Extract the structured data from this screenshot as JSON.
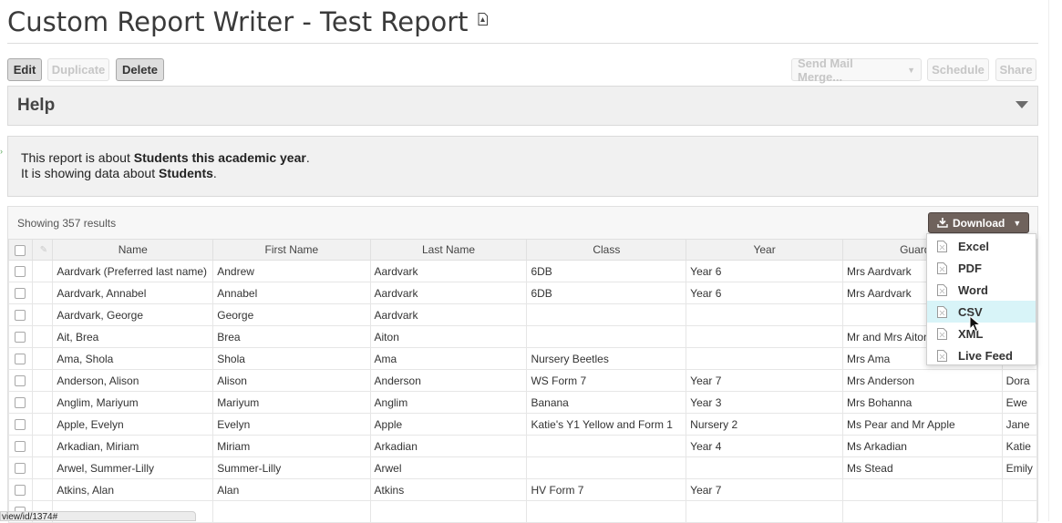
{
  "page": {
    "title": "Custom Report Writer - Test Report",
    "title_icon": "pdf-icon"
  },
  "toolbar": {
    "edit": "Edit",
    "duplicate": "Duplicate",
    "delete": "Delete",
    "send_mail_merge": "Send Mail Merge...",
    "schedule": "Schedule",
    "share": "Share"
  },
  "help": {
    "title": "Help",
    "toggle_icon": "triangle-down-icon"
  },
  "about": {
    "line1_prefix": "This report is about ",
    "line1_bold": "Students this academic year",
    "line1_suffix": ".",
    "line2_prefix": "It is showing data about ",
    "line2_bold": "Students",
    "line2_suffix": "."
  },
  "results": {
    "count_text": "Showing 357 results",
    "download_label": "Download",
    "download_icon": "download-icon"
  },
  "table": {
    "columns": [
      "Name",
      "First Name",
      "Last Name",
      "Class",
      "Year",
      "Guardian",
      ""
    ],
    "rows": [
      [
        "Aardvark (Preferred last name)",
        "Andrew",
        "Aardvark",
        "6DB",
        "Year 6",
        "Mrs Aardvark",
        ""
      ],
      [
        "Aardvark, Annabel",
        "Annabel",
        "Aardvark",
        "6DB",
        "Year 6",
        "Mrs Aardvark",
        ""
      ],
      [
        "Aardvark, George",
        "George",
        "Aardvark",
        "",
        "",
        "",
        ""
      ],
      [
        "Ait, Brea",
        "Brea",
        "Aiton",
        "",
        "",
        "Mr and Mrs Aiton",
        ""
      ],
      [
        "Ama, Shola",
        "Shola",
        "Ama",
        "Nursery Beetles",
        "",
        "Mrs Ama",
        ""
      ],
      [
        "Anderson, Alison",
        "Alison",
        "Anderson",
        "WS Form 7",
        "Year 7",
        "Mrs Anderson",
        "Dora"
      ],
      [
        "Anglim, Mariyum",
        "Mariyum",
        "Anglim",
        "Banana",
        "Year 3",
        "Mrs Bohanna",
        "Ewe"
      ],
      [
        "Apple, Evelyn",
        "Evelyn",
        "Apple",
        "Katie's Y1 Yellow and Form 1",
        "Nursery 2",
        "Ms Pear and Mr Apple",
        "Jane"
      ],
      [
        "Arkadian, Miriam",
        "Miriam",
        "Arkadian",
        "",
        "Year 4",
        "Ms Arkadian",
        "Katie"
      ],
      [
        "Arwel, Summer-Lilly",
        "Summer-Lilly",
        "Arwel",
        "",
        "",
        "Ms Stead",
        "Emily"
      ],
      [
        "Atkins, Alan",
        "Alan",
        "Atkins",
        "HV Form 7",
        "Year 7",
        "",
        ""
      ],
      [
        "",
        "",
        "",
        "",
        "",
        "",
        ""
      ]
    ]
  },
  "download_menu": {
    "items": [
      {
        "label": "Excel",
        "icon": "excel-file-icon"
      },
      {
        "label": "PDF",
        "icon": "pdf-file-icon"
      },
      {
        "label": "Word",
        "icon": "word-file-icon"
      },
      {
        "label": "CSV",
        "icon": "csv-file-icon",
        "active": true
      },
      {
        "label": "XML",
        "icon": "xml-file-icon"
      },
      {
        "label": "Live Feed",
        "icon": "feed-file-icon"
      }
    ]
  },
  "status_bar": {
    "url_text": "view/id/1374#"
  },
  "colors": {
    "download_button": "#6f625c",
    "menu_highlight": "#d8f4f8",
    "panel_background": "#f1f1f1"
  }
}
